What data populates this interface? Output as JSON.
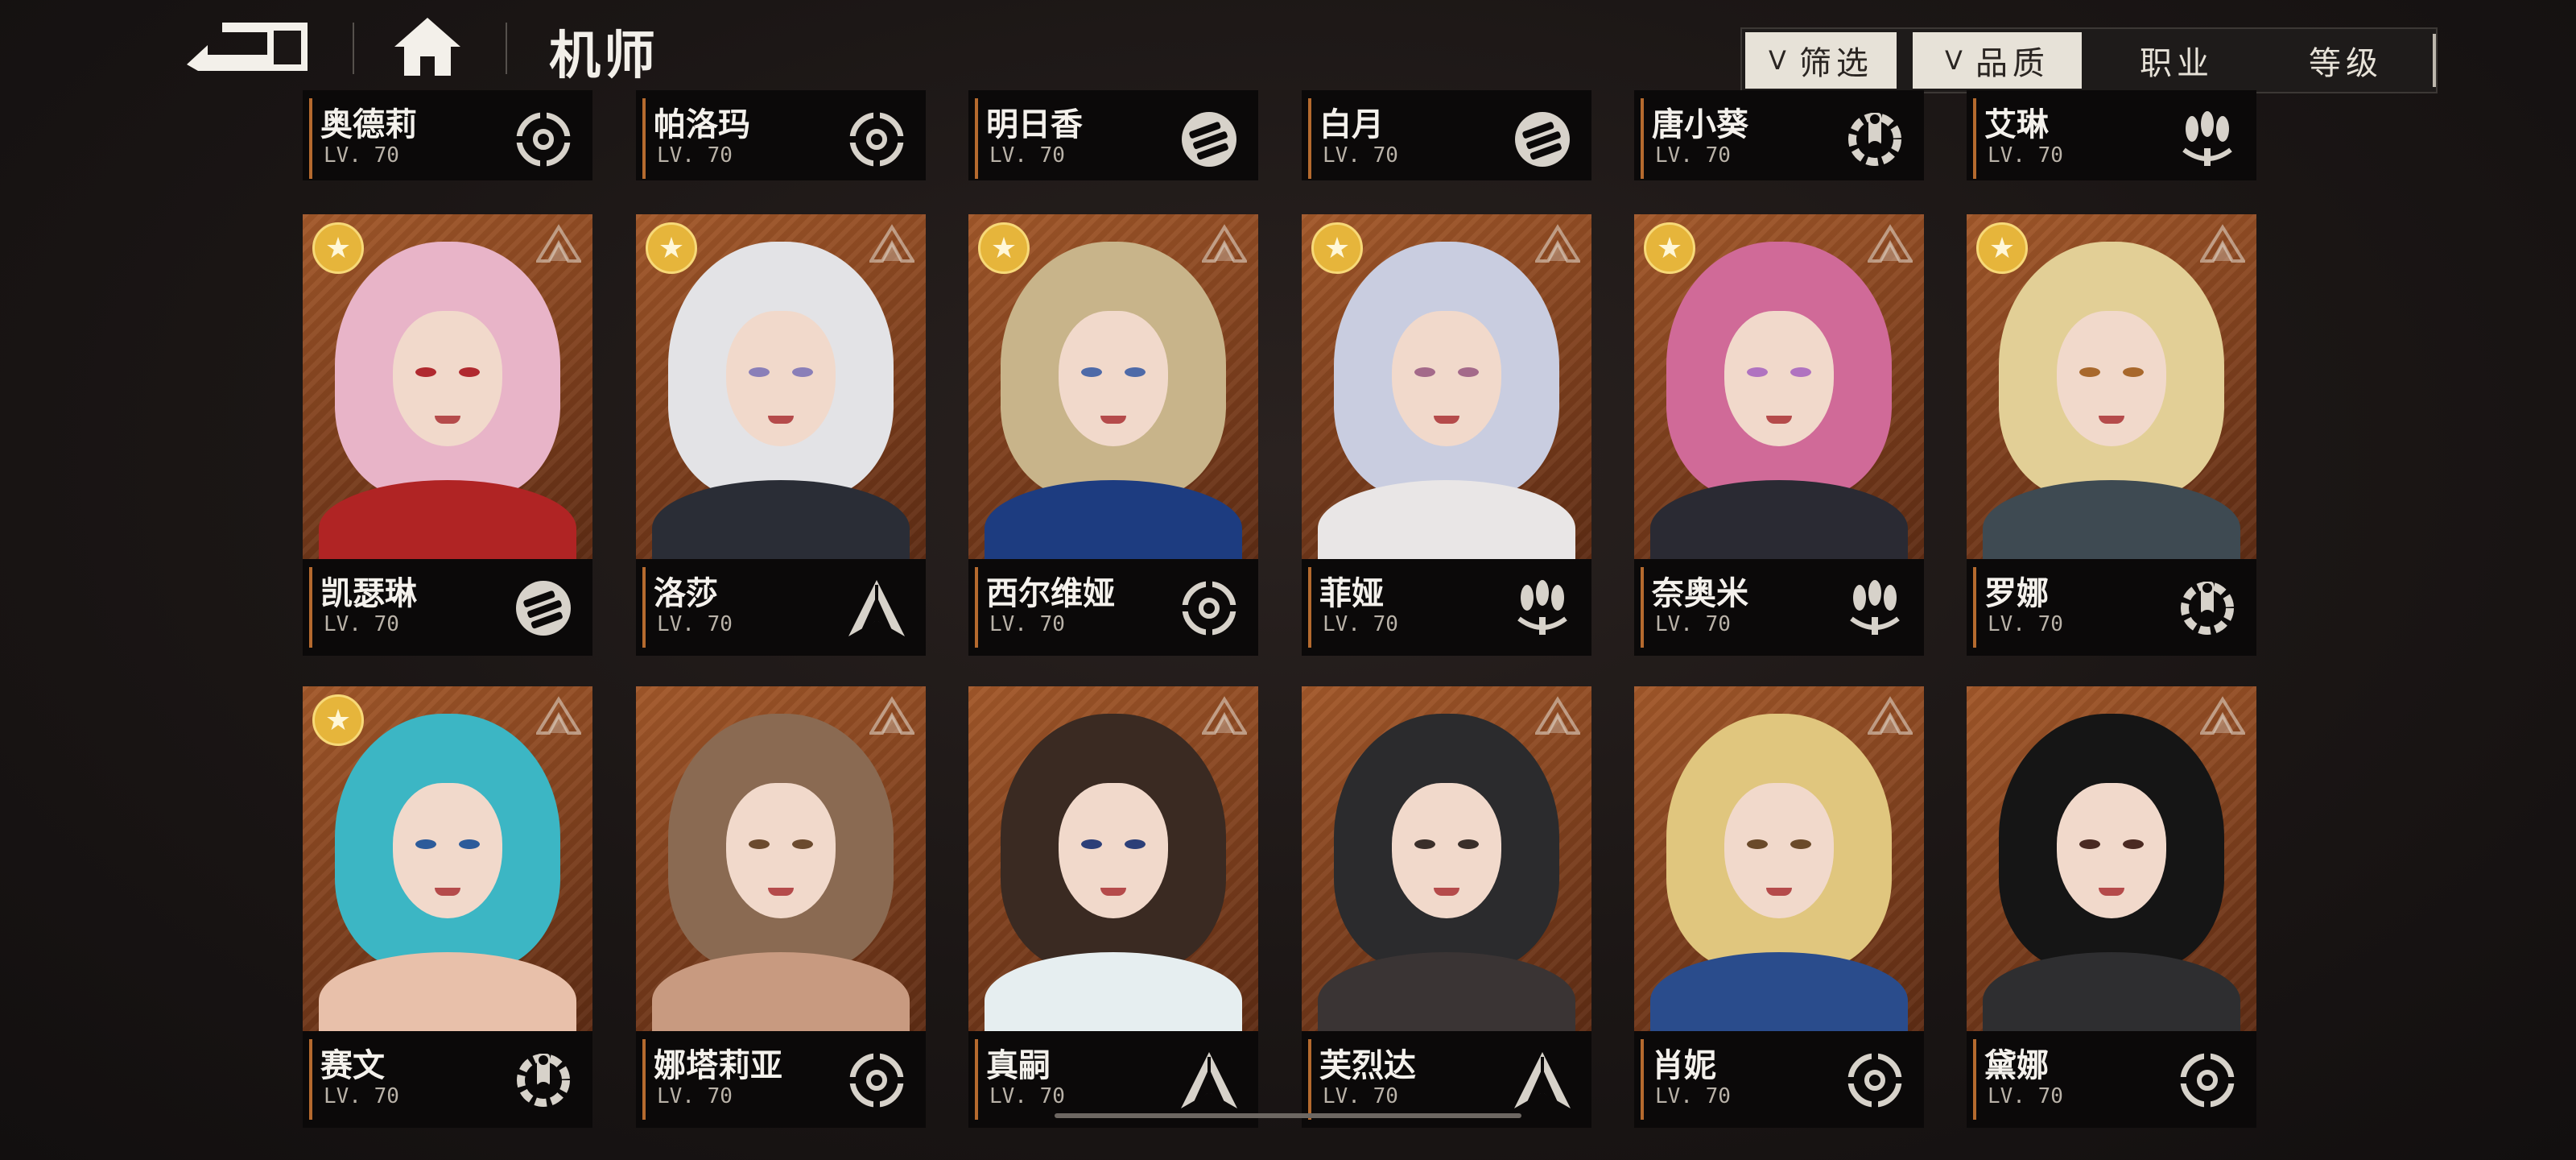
{
  "header": {
    "title": "机师"
  },
  "filters": {
    "filter_label": "筛选",
    "quality_label": "品质",
    "class_label": "职业",
    "level_label": "等级"
  },
  "colors": {
    "card_bg": "#8a4520",
    "star": "#e6b53b",
    "accent_edge": "#b56a2e"
  },
  "rows": [
    {
      "partial": true,
      "cards": [
        {
          "name": "奥德莉",
          "level": "LV. 70",
          "role_icon": "target-ring-icon"
        },
        {
          "name": "帕洛玛",
          "level": "LV. 70",
          "role_icon": "target-ring-icon"
        },
        {
          "name": "明日香",
          "level": "LV. 70",
          "role_icon": "fist-icon"
        },
        {
          "name": "白月",
          "level": "LV. 70",
          "role_icon": "fist-icon"
        },
        {
          "name": "唐小葵",
          "level": "LV. 70",
          "role_icon": "wrench-gear-icon"
        },
        {
          "name": "艾琳",
          "level": "LV. 70",
          "role_icon": "triple-missile-icon"
        }
      ]
    },
    {
      "partial": false,
      "cards": [
        {
          "name": "凯瑟琳",
          "level": "LV. 70",
          "role_icon": "fist-icon",
          "star": true,
          "hair": "#e8b4c8",
          "eyes": "#b0292f",
          "body": "#b02424"
        },
        {
          "name": "洛莎",
          "level": "LV. 70",
          "role_icon": "arrowhead-icon",
          "star": true,
          "hair": "#e3e3e6",
          "eyes": "#8a7fb8",
          "body": "#2a2d36"
        },
        {
          "name": "西尔维娅",
          "level": "LV. 70",
          "role_icon": "target-ring-icon",
          "star": true,
          "hair": "#c8b48a",
          "eyes": "#4e6aa8",
          "body": "#1d3c80"
        },
        {
          "name": "菲娅",
          "level": "LV. 70",
          "role_icon": "triple-missile-icon",
          "star": true,
          "hair": "#c9cde0",
          "eyes": "#a46a8a",
          "body": "#e9e6e6"
        },
        {
          "name": "奈奥米",
          "level": "LV. 70",
          "role_icon": "triple-missile-icon",
          "star": true,
          "hair": "#d06a98",
          "eyes": "#b073c0",
          "body": "#2a2a33"
        },
        {
          "name": "罗娜",
          "level": "LV. 70",
          "role_icon": "wrench-gear-icon",
          "star": true,
          "hair": "#e2cf96",
          "eyes": "#a8682c",
          "body": "#3e4a52"
        }
      ]
    },
    {
      "partial": false,
      "cards": [
        {
          "name": "赛文",
          "level": "LV. 70",
          "role_icon": "wrench-gear-icon",
          "star": true,
          "hair": "#3cb6c4",
          "eyes": "#2c5b9a",
          "body": "#e8c0aa"
        },
        {
          "name": "娜塔莉亚",
          "level": "LV. 70",
          "role_icon": "target-ring-icon",
          "star": false,
          "hair": "#8a6a52",
          "eyes": "#6b4a2e",
          "body": "#c89a80"
        },
        {
          "name": "真嗣",
          "level": "LV. 70",
          "role_icon": "arrowhead-icon",
          "star": false,
          "hair": "#3a2a22",
          "eyes": "#2c3f78",
          "body": "#e6eef0"
        },
        {
          "name": "芙烈达",
          "level": "LV. 70",
          "role_icon": "arrowhead-icon",
          "star": false,
          "hair": "#2b2b2d",
          "eyes": "#3a2f2a",
          "body": "#3a3434"
        },
        {
          "name": "肖妮",
          "level": "LV. 70",
          "role_icon": "target-ring-icon",
          "star": false,
          "hair": "#e0c67e",
          "eyes": "#6a4a2a",
          "body": "#2a4c8c"
        },
        {
          "name": "黛娜",
          "level": "LV. 70",
          "role_icon": "target-ring-icon",
          "star": false,
          "hair": "#151515",
          "eyes": "#4a2a22",
          "body": "#2e2e30"
        }
      ]
    }
  ]
}
